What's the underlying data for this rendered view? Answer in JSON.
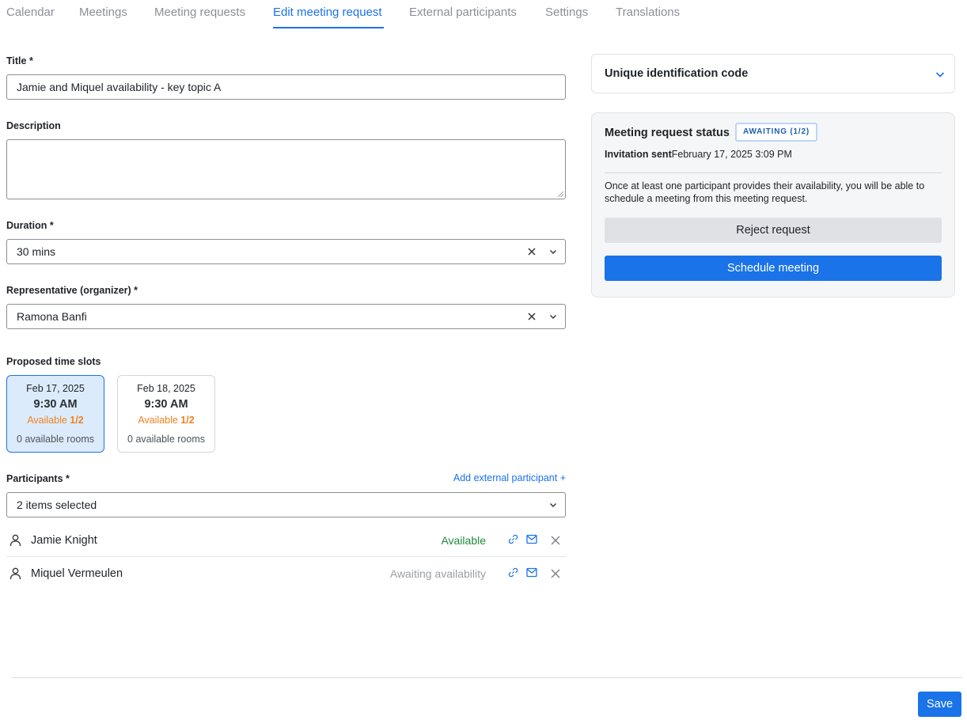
{
  "tabs": [
    {
      "label": "Calendar"
    },
    {
      "label": "Meetings"
    },
    {
      "label": "Meeting requests"
    },
    {
      "label": "Edit meeting request",
      "active": true
    },
    {
      "label": "External participants"
    },
    {
      "label": "Settings"
    },
    {
      "label": "Translations"
    }
  ],
  "form": {
    "title_label": "Title *",
    "title_value": "Jamie and Miquel availability - key topic A",
    "description_label": "Description",
    "description_value": "",
    "duration_label": "Duration *",
    "duration_value": "30 mins",
    "representative_label": "Representative (organizer) *",
    "representative_value": "Ramona Banfi",
    "slots_label": "Proposed time slots",
    "participants_label": "Participants *",
    "participants_value": "2 items selected",
    "add_external_label": "Add external participant +"
  },
  "slots": [
    {
      "date": "Feb 17, 2025",
      "time": "9:30 AM",
      "avail_prefix": "Available ",
      "avail_count": "1/2",
      "rooms": "0 available rooms",
      "selected": true
    },
    {
      "date": "Feb 18, 2025",
      "time": "9:30 AM",
      "avail_prefix": "Available ",
      "avail_count": "1/2",
      "rooms": "0 available rooms",
      "selected": false
    }
  ],
  "participants": [
    {
      "name": "Jamie Knight",
      "status": "Available",
      "status_color": "#1e8a3c"
    },
    {
      "name": "Miquel Vermeulen",
      "status": "Awaiting availability",
      "status_color": "#9aa0a6"
    }
  ],
  "uid_panel": {
    "title": "Unique identification code"
  },
  "status_panel": {
    "title": "Meeting request status",
    "badge": "AWAITING (1/2)",
    "sent_key": "Invitation sent",
    "sent_value": "February 17, 2025 3:09 PM",
    "info": "Once at least one participant provides their availability, you will be able to schedule a meeting from this meeting request.",
    "reject_label": "Reject request",
    "schedule_label": "Schedule meeting"
  },
  "footer": {
    "save_label": "Save"
  },
  "colors": {
    "accent": "#1a73e8",
    "orange": "#f0811e",
    "green": "#1e8a3c"
  }
}
